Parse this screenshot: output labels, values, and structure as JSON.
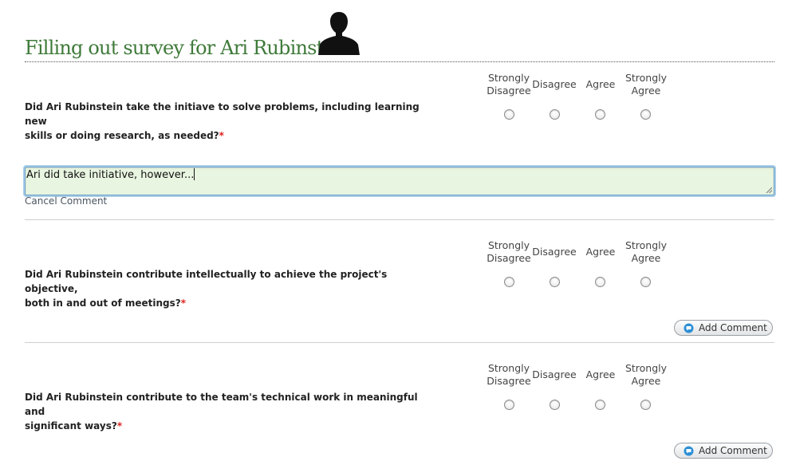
{
  "survey": {
    "title": "Filling out survey for Ari Rubinstein",
    "required_marker": "*"
  },
  "scale": {
    "strongly_disagree": [
      "Strongly",
      "Disagree"
    ],
    "disagree": "Disagree",
    "agree": "Agree",
    "strongly_agree": [
      "Strongly",
      "Agree"
    ]
  },
  "questions": [
    {
      "text_line1": "Did Ari Rubinstein take the initiave to solve problems, including learning new",
      "text_line2": "skills or doing research, as needed?",
      "comment_value": "Ari did take initiative, however...",
      "cancel_label": "Cancel Comment"
    },
    {
      "text_line1": "Did Ari Rubinstein contribute intellectually to achieve the project's objective,",
      "text_line2": "both in and out of meetings?",
      "add_comment_label": "Add Comment"
    },
    {
      "text_line1": "Did Ari Rubinstein contribute to the team's technical work in meaningful and",
      "text_line2": "significant ways?",
      "add_comment_label": "Add Comment"
    }
  ],
  "icons": {
    "avatar": "person-silhouette-icon",
    "comment": "speech-bubble-icon"
  },
  "colors": {
    "title": "#3f7a3a",
    "required": "#e02020",
    "comment_bg": "#e8f5e0",
    "focus_ring": "#a9cde8"
  }
}
